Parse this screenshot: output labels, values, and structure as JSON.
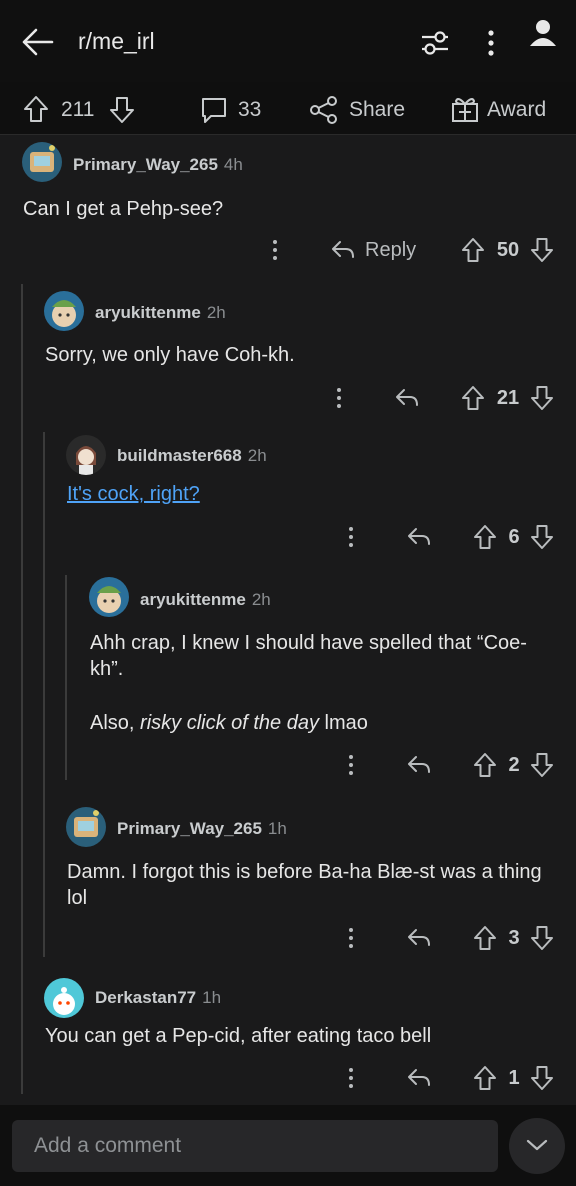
{
  "header": {
    "title": "r/me_irl"
  },
  "actions": {
    "upvotes": "211",
    "comments": "33",
    "share_label": "Share",
    "award_label": "Award"
  },
  "comments": [
    {
      "user": "Primary_Way_265",
      "time": "4h",
      "text": "Can I get a Pehp-see?",
      "reply_label": "Reply",
      "votes": "50"
    },
    {
      "user": "aryukittenme",
      "time": "2h",
      "text": "Sorry, we only have Coh-kh.",
      "votes": "21"
    },
    {
      "user": "buildmaster668",
      "time": "2h",
      "text": "It's cock, right?",
      "votes": "6"
    },
    {
      "user": "aryukittenme",
      "time": "2h",
      "text1": "Ahh crap, I knew I should have spelled that “Coe-kh”.",
      "text2_pre": "Also, ",
      "text2_em": "risky click of the day",
      "text2_post": " lmao",
      "votes": "2"
    },
    {
      "user": "Primary_Way_265",
      "time": "1h",
      "text": "Damn. I forgot this is before Ba-ha Blæ-st was a thing lol",
      "votes": "3"
    },
    {
      "user": "Derkastan77",
      "time": "1h",
      "text": "You can get a Pep-cid, after eating taco bell",
      "votes": "1"
    }
  ],
  "footer": {
    "placeholder": "Add a comment"
  },
  "colors": {
    "background": "#1a1a1b",
    "link": "#4fa3f7",
    "thread_line": "#3b3b3b"
  }
}
